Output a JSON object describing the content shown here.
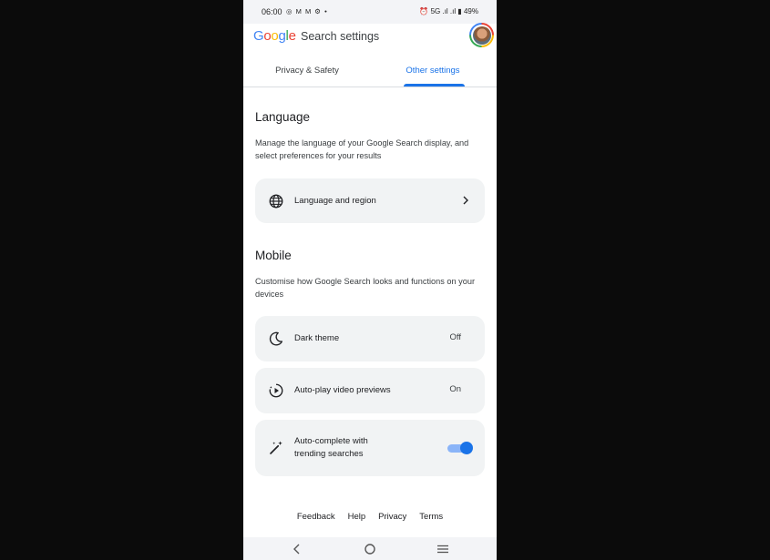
{
  "status_bar": {
    "time": "06:00",
    "left_icons": "◎ M M ⚙ •",
    "right_text": "⏰ 5G .ıl .ıl ▮ 49%"
  },
  "header": {
    "logo_text": "Google",
    "title": "Search settings",
    "tabs": [
      {
        "label": "Privacy & Safety",
        "active": false
      },
      {
        "label": "Other settings",
        "active": true
      }
    ]
  },
  "language_section": {
    "title": "Language",
    "description": "Manage the language of your Google Search display, and select preferences for your results",
    "item": {
      "label": "Language and region",
      "icon": "globe-icon"
    }
  },
  "mobile_section": {
    "title": "Mobile",
    "description": "Customise how Google Search looks and functions on your devices",
    "items": [
      {
        "label": "Dark theme",
        "value": "Off",
        "icon": "moon-icon"
      },
      {
        "label": "Auto-play video previews",
        "value": "On",
        "icon": "autoplay-icon"
      },
      {
        "label": "Auto-complete with trending searches",
        "toggle": true,
        "icon": "magic-wand-icon"
      }
    ]
  },
  "footer": {
    "links": [
      "Feedback",
      "Help",
      "Privacy",
      "Terms"
    ]
  },
  "colors": {
    "accent": "#1a73e8",
    "card_bg": "#f1f3f4",
    "background": "#0b0b0b"
  }
}
